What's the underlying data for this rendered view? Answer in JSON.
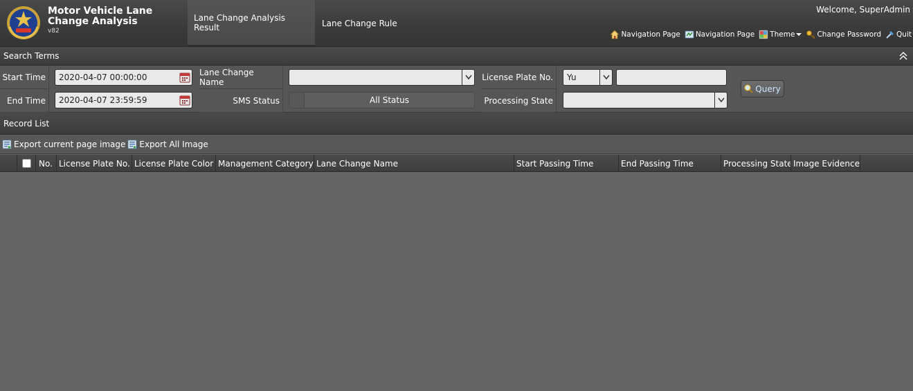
{
  "app": {
    "title": "Motor Vehicle Lane Change Analysis",
    "version": "v82",
    "logo_icon": "police-emblem-icon"
  },
  "nav": {
    "tabs": [
      {
        "label": "Lane Change Analysis Result",
        "active": true
      },
      {
        "label": "Lane Change Rule",
        "active": false
      }
    ]
  },
  "user": {
    "welcome": "Welcome, SuperAdmin"
  },
  "toplinks": [
    {
      "label": "Navigation Page",
      "icon": "home-icon"
    },
    {
      "label": "Navigation Page",
      "icon": "navigation-icon"
    },
    {
      "label": "Theme",
      "icon": "theme-icon"
    },
    {
      "label": "Change Password",
      "icon": "key-icon"
    },
    {
      "label": "Quit",
      "icon": "quit-icon"
    }
  ],
  "search": {
    "section_title": "Search Terms",
    "start_time_label": "Start Time",
    "start_time_value": "2020-04-07 00:00:00",
    "end_time_label": "End Time",
    "end_time_value": "2020-04-07 23:59:59",
    "lane_change_name_label": "Lane Change Name",
    "lane_change_name_value": "",
    "sms_status_label": "SMS Status",
    "sms_status_value": "All Status",
    "plate_label": "License Plate No.",
    "plate_prefix": "Yu",
    "plate_value": "",
    "processing_state_label": "Processing State",
    "processing_state_value": "",
    "query_label": "Query"
  },
  "records": {
    "section_title": "Record List",
    "export_page_label": "Export current page image",
    "export_all_label": "Export All Image",
    "columns": [
      "No.",
      "License Plate No.",
      "License Plate Color",
      "Management Category",
      "Lane Change Name",
      "Start Passing Time",
      "End Passing Time",
      "Processing State",
      "Image Evidence"
    ],
    "rows": []
  },
  "colors": {
    "header_bg": "#3a3a3a",
    "body_bg": "#646464",
    "query_text": "#cde6ff"
  }
}
